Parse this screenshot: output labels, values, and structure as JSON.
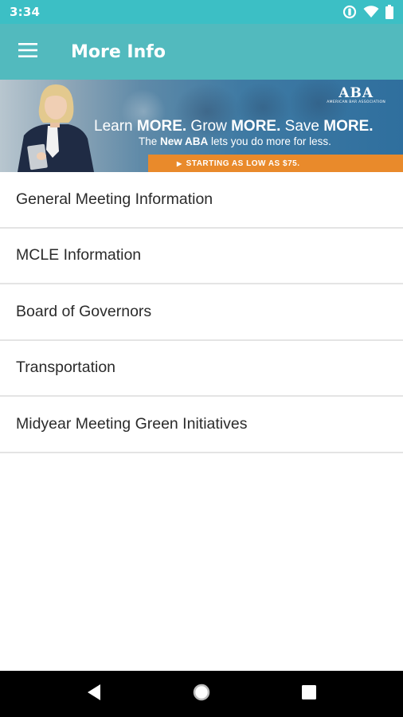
{
  "status_bar": {
    "time": "3:34",
    "icons": [
      "data-saver-icon",
      "wifi-icon",
      "battery-icon"
    ]
  },
  "app_bar": {
    "title": "More Info",
    "menu_icon": "hamburger-menu-icon"
  },
  "banner": {
    "logo_mark": "ABA",
    "logo_sub": "AMERICAN BAR ASSOCIATION",
    "headline": {
      "p1": "Learn ",
      "b1": "MORE.",
      "p2": " Grow ",
      "b2": "MORE.",
      "p3": " Save ",
      "b3": "MORE."
    },
    "subline": {
      "p1": "The ",
      "b1": "New ABA",
      "p2": " lets you do more for less."
    },
    "strip": {
      "text": "STARTING AS LOW AS ",
      "price": "$75."
    }
  },
  "list": {
    "items": [
      {
        "label": "General Meeting Information"
      },
      {
        "label": "MCLE Information"
      },
      {
        "label": "Board of Governors"
      },
      {
        "label": "Transportation"
      },
      {
        "label": "Midyear Meeting Green Initiatives"
      }
    ]
  },
  "nav_bar": {
    "icons": [
      "back-icon",
      "home-icon",
      "recents-icon"
    ]
  },
  "colors": {
    "status_bar": "#3cbfc5",
    "app_bar": "#52babe",
    "banner_strip": "#e98a2b",
    "divider": "#e4e4e4"
  }
}
